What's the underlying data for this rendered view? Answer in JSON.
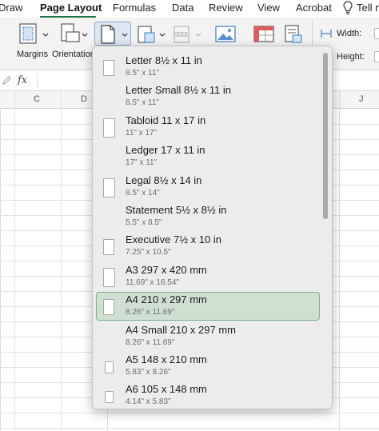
{
  "tabs": {
    "items": [
      {
        "label": "Draw"
      },
      {
        "label": "Page Layout"
      },
      {
        "label": "Formulas"
      },
      {
        "label": "Data"
      },
      {
        "label": "Review"
      },
      {
        "label": "View"
      },
      {
        "label": "Acrobat"
      },
      {
        "label": "Tell m"
      }
    ],
    "active": "Page Layout",
    "accent": "#217346"
  },
  "ribbon": {
    "margins_label": "Margins",
    "orientation_label": "Orientation",
    "width_label": "Width:",
    "height_label": "Height:"
  },
  "formula_bar": {
    "fx_label": "fx"
  },
  "columns": [
    "C",
    "D",
    "J"
  ],
  "paper_size_menu": {
    "items": [
      {
        "name": "Letter 8½ x 11 in",
        "dims": "8.5\" x 11\"",
        "icon": "portrait-page-icon"
      },
      {
        "name": "Letter Small 8½ x 11 in",
        "dims": "8.5\" x 11\"",
        "icon": "none"
      },
      {
        "name": "Tabloid 11 x 17 in",
        "dims": "11\" x 17\"",
        "icon": "portrait-page-icon"
      },
      {
        "name": "Ledger 17 x 11 in",
        "dims": "17\" x 11\"",
        "icon": "none"
      },
      {
        "name": "Legal 8½ x 14 in",
        "dims": "8.5\" x 14\"",
        "icon": "portrait-page-icon"
      },
      {
        "name": "Statement 5½ x 8½ in",
        "dims": "5.5\" x 8.5\"",
        "icon": "none"
      },
      {
        "name": "Executive 7½ x 10 in",
        "dims": "7.25\" x 10.5\"",
        "icon": "portrait-page-icon"
      },
      {
        "name": "A3 297 x 420 mm",
        "dims": "11.69\" x 16.54\"",
        "icon": "portrait-page-icon"
      },
      {
        "name": "A4 210 x 297 mm",
        "dims": "8.26\" x 11.69\"",
        "icon": "portrait-page-icon"
      },
      {
        "name": "A4 Small 210 x 297 mm",
        "dims": "8.26\" x 11.69\"",
        "icon": "none"
      },
      {
        "name": "A5 148 x 210 mm",
        "dims": "5.83\" x 8.26\"",
        "icon": "portrait-page-icon"
      },
      {
        "name": "A6 105 x 148 mm",
        "dims": "4.14\" x 5.83\"",
        "icon": "portrait-page-icon"
      }
    ],
    "selected": "A4 210 x 297 mm",
    "selected_color": "#cfe0d2"
  }
}
